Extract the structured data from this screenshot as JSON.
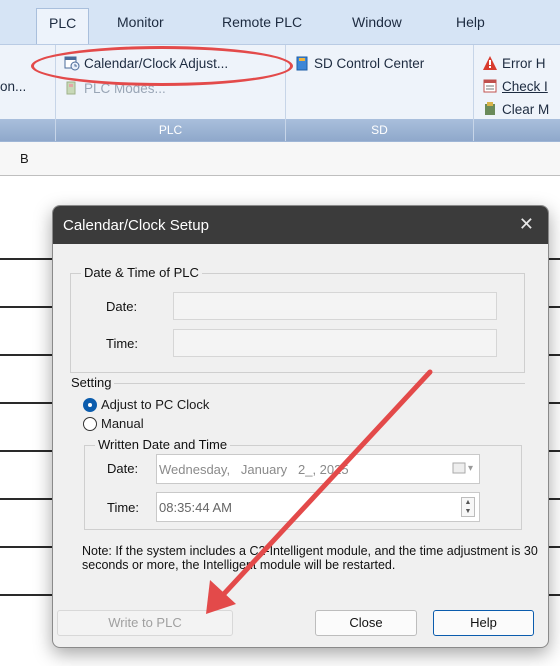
{
  "menu": {
    "tabs": [
      "PLC",
      "Monitor",
      "Remote PLC",
      "Window",
      "Help"
    ],
    "active": "PLC"
  },
  "ribbon": {
    "left_fragment": "on...",
    "plc_group": {
      "label": "PLC",
      "calendar_clock_adjust": "Calendar/Clock Adjust...",
      "plc_modes": "PLC Modes..."
    },
    "sd_group": {
      "label": "SD",
      "sd_control_center": "SD Control Center"
    },
    "right_group": {
      "error": "Error H",
      "check": "Check I",
      "clear": "Clear M"
    }
  },
  "sheet": {
    "col_b": "B"
  },
  "dialog": {
    "title": "Calendar/Clock Setup",
    "plc_group": {
      "label": "Date & Time of PLC",
      "date_label": "Date:",
      "time_label": "Time:",
      "date_value": "",
      "time_value": ""
    },
    "setting": {
      "label": "Setting",
      "adjust_pc": "Adjust to PC Clock",
      "manual": "Manual",
      "selected": "Adjust to PC Clock",
      "written": {
        "label": "Written Date and Time",
        "date_label": "Date:",
        "date_value": "Wednesday,   January   2_, 2025",
        "time_label": "Time:",
        "time_value": "08:35:44 AM"
      }
    },
    "note": "Note: If the system includes a C2-Intelligent module, and the time adjustment is 30 seconds or more, the Intelligent module will be restarted.",
    "buttons": {
      "write": "Write to PLC",
      "close": "Close",
      "help": "Help"
    }
  },
  "colors": {
    "annotation": "#e34a4a",
    "accent": "#0b5cad",
    "titlebar": "#3b3b3b"
  }
}
